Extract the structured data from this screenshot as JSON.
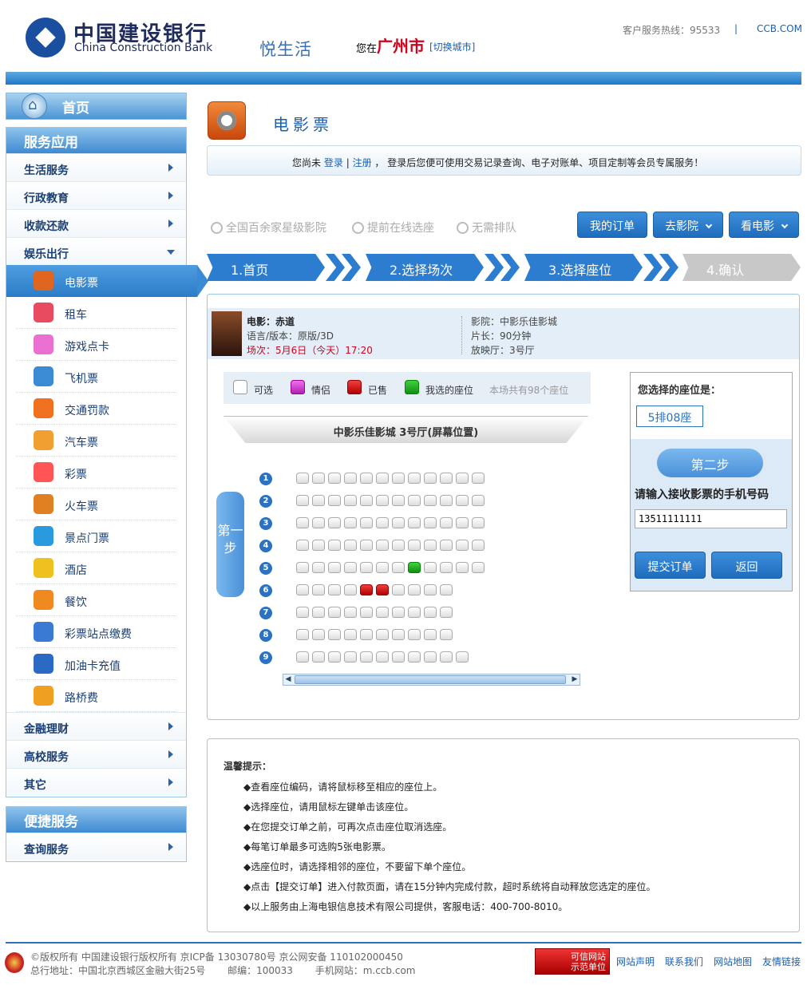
{
  "header": {
    "logo_cn": "中国建设银行",
    "logo_en": "China Construction Bank",
    "brand": "悦生活",
    "loc_prefix": "您在",
    "city": "广州市",
    "switch_city": "[切换城市]",
    "hotline": "客户服务热线：95533",
    "sep": "|",
    "site": "CCB.COM"
  },
  "sidebar": {
    "home": "首页",
    "service_head": "服务应用",
    "cats": [
      "生活服务",
      "行政教育",
      "收款还款",
      "娱乐出行"
    ],
    "subs": [
      {
        "label": "电影票",
        "icon": "film-reel-icon",
        "color": "#e0651e"
      },
      {
        "label": "租车",
        "icon": "car-rental-icon",
        "color": "#e84a5f"
      },
      {
        "label": "游戏点卡",
        "icon": "gamepad-icon",
        "color": "#e96fd0"
      },
      {
        "label": "飞机票",
        "icon": "airplane-icon",
        "color": "#3a8ad4"
      },
      {
        "label": "交通罚款",
        "icon": "traffic-car-icon",
        "color": "#f07020"
      },
      {
        "label": "汽车票",
        "icon": "bus-icon",
        "color": "#f0a030"
      },
      {
        "label": "彩票",
        "icon": "star-lottery-icon",
        "color": "#f55"
      },
      {
        "label": "火车票",
        "icon": "train-icon",
        "color": "#e08020"
      },
      {
        "label": "景点门票",
        "icon": "palm-tree-icon",
        "color": "#2a9adf"
      },
      {
        "label": "酒店",
        "icon": "hotel-icon",
        "color": "#f0c020"
      },
      {
        "label": "餐饮",
        "icon": "dining-icon",
        "color": "#f08a20"
      },
      {
        "label": "彩票站点缴费",
        "icon": "lottery-balls-icon",
        "color": "#3a7ad4"
      },
      {
        "label": "加油卡充值",
        "icon": "fuel-pump-icon",
        "color": "#2a6ac4"
      },
      {
        "label": "路桥费",
        "icon": "toll-road-icon",
        "color": "#f0a020"
      }
    ],
    "cats2": [
      "金融理财",
      "高校服务",
      "其它"
    ],
    "quick_head": "便捷服务",
    "quick": "查询服务"
  },
  "main": {
    "title": "电影票",
    "login_pre": "您尚未",
    "login": "登录",
    "bar": "|",
    "register": "注册",
    "login_post": "，  登录后您便可使用交易记录查询、电子对账单、项目定制等会员专属服务！",
    "features": [
      "全国百余家星级影院",
      "提前在线选座",
      "无需排队"
    ],
    "top_buttons": [
      "我的订单",
      "去影院",
      "看电影"
    ],
    "steps": [
      "1.首页",
      "2.选择场次",
      "3.选择座位",
      "4.确认"
    ]
  },
  "movie": {
    "name": "电影：赤道",
    "lang": "语言/版本：原版/3D",
    "session": "场次：5月6日（今天）17:20",
    "cinema": "影院：中影乐佳影城",
    "length": "片长：90分钟",
    "hall": "放映厅：3号厅"
  },
  "legend": {
    "avail": "可选",
    "couple": "情侣",
    "sold": "已售",
    "mine": "我选的座位",
    "total": "本场共有98个座位"
  },
  "screen": "中影乐佳影城 3号厅(屏幕位置)",
  "step1": "第一步",
  "rows": [
    {
      "n": "1",
      "seats": "aaaaaaaaaaaa"
    },
    {
      "n": "2",
      "seats": "aaaaaaaaaaaa"
    },
    {
      "n": "3",
      "seats": "aaaaaaaaaaaa"
    },
    {
      "n": "4",
      "seats": "aaaaaaaaaaaa"
    },
    {
      "n": "5",
      "seats": "aaaaaaamaaaa"
    },
    {
      "n": "6",
      "seats": "aaaassaaaa"
    },
    {
      "n": "7",
      "seats": "aaaaaaaaaa"
    },
    {
      "n": "8",
      "seats": "aaaaaaaaaa"
    },
    {
      "n": "9",
      "seats": "aaaaaaaaaaa"
    }
  ],
  "right": {
    "title": "您选择的座位是：",
    "seat": "5排08座",
    "step2": "第二步",
    "prompt": "请输入接收影票的手机号码",
    "phone": "13511111111",
    "submit": "提交订单",
    "back": "返回"
  },
  "tips": {
    "head": "温馨提示：",
    "items": [
      "◆查看座位编码，请将鼠标移至相应的座位上。",
      "◆选择座位，请用鼠标左键单击该座位。",
      "◆在您提交订单之前，可再次点击座位取消选座。",
      "◆每笔订单最多可选购5张电影票。",
      "◆选座位时，请选择相邻的座位，不要留下单个座位。",
      "◆点击【提交订单】进入付款页面，请在15分钟内完成付款，超时系统将自动释放您选定的座位。",
      "◆以上服务由上海电银信息技术有限公司提供，客服电话：400-700-8010。"
    ]
  },
  "footer": {
    "line1": "©版权所有 中国建设银行版权所有 京ICP备 13030780号 京公网安备 110102000450",
    "line2": "总行地址：中国北京西城区金融大街25号　　 邮编：100033　　 手机网站：m.ccb.com",
    "trust": "可信网站 示范单位",
    "links": [
      "网站声明",
      "联系我们",
      "网站地图",
      "友情链接"
    ]
  }
}
